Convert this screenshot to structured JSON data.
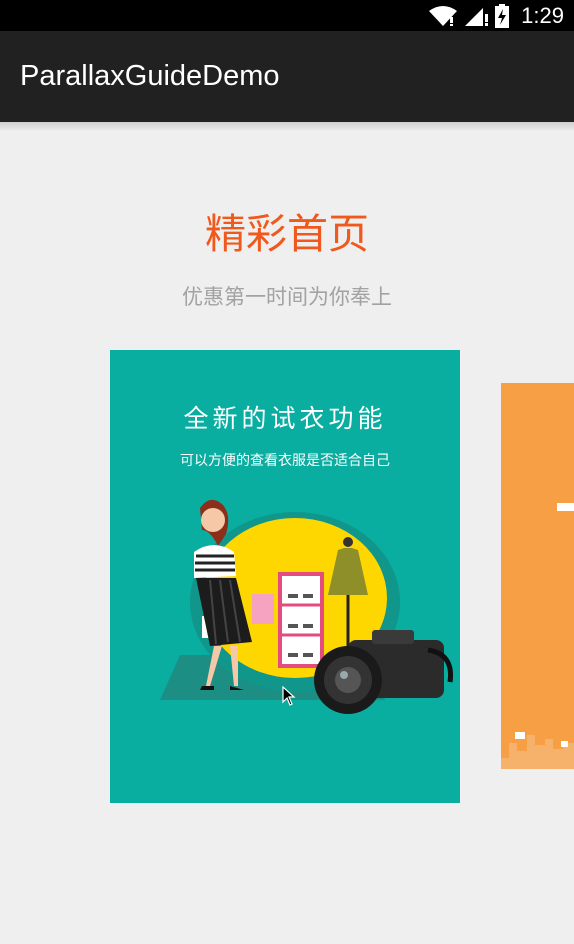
{
  "status_bar": {
    "time": "1:29",
    "icons": [
      "wifi-icon",
      "signal-icon",
      "battery-charging-icon"
    ]
  },
  "app_bar": {
    "title": "ParallaxGuideDemo",
    "background": "#212121"
  },
  "guide": {
    "title": "精彩首页",
    "subtitle": "优惠第一时间为你奉上",
    "title_color": "#f0591d",
    "subtitle_color": "#a2a2a2"
  },
  "pages": [
    {
      "heading": "全新的试衣功能",
      "description": "可以方便的查看衣服是否适合自己",
      "background": "#0aaea1",
      "illustration": [
        "woman-shopping-illustration",
        "dress-mannequin-illustration",
        "shoe-shelf-illustration",
        "camera-illustration"
      ]
    },
    {
      "background": "#f79f45",
      "illustration": [
        "city-skyline-illustration"
      ]
    }
  ]
}
